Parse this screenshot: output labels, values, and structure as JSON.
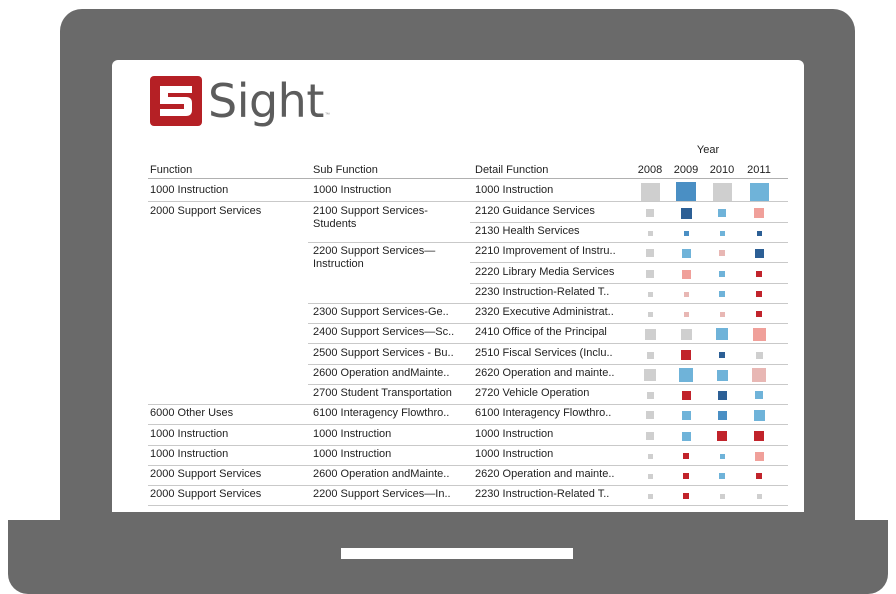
{
  "brand": {
    "logo_digit": "5",
    "logo_text": "Sight",
    "tm": "™"
  },
  "table": {
    "year_title": "Year",
    "headers": {
      "function": "Function",
      "sub_function": "Sub Function",
      "detail_function": "Detail Function"
    },
    "years": [
      "2008",
      "2009",
      "2010",
      "2011"
    ],
    "colors": {
      "grey": "#cfcfcf",
      "light_blue": "#6fb3d9",
      "blue": "#4a8fc4",
      "navy": "#2c5f95",
      "salmon": "#f0a09a",
      "pink": "#e8b7b4",
      "red": "#c1232b"
    },
    "rows": [
      {
        "function": "1000   Instruction",
        "sub": "1000   Instruction",
        "detail": "1000   Instruction",
        "size": "xl",
        "marks": [
          {
            "color": "grey",
            "level": 0.95
          },
          {
            "color": "blue",
            "level": 1.0
          },
          {
            "color": "grey",
            "level": 0.9
          },
          {
            "color": "light_blue",
            "level": 0.95
          }
        ]
      },
      {
        "function": "2000   Support Services",
        "sub": "2100   Support Services-Students",
        "detail": "2120   Guidance Services",
        "marks": [
          {
            "color": "grey",
            "level": 0.25
          },
          {
            "color": "navy",
            "level": 0.45
          },
          {
            "color": "light_blue",
            "level": 0.25
          },
          {
            "color": "salmon",
            "level": 0.4
          }
        ]
      },
      {
        "function": "",
        "sub": "",
        "detail": "2130   Health Services",
        "marks": [
          {
            "color": "grey",
            "level": 0.08
          },
          {
            "color": "blue",
            "level": 0.1
          },
          {
            "color": "light_blue",
            "level": 0.1
          },
          {
            "color": "navy",
            "level": 0.1
          }
        ]
      },
      {
        "function": "",
        "sub": "2200   Support Services—Instruction",
        "detail": "2210   Improvement of Instru..",
        "marks": [
          {
            "color": "grey",
            "level": 0.25
          },
          {
            "color": "light_blue",
            "level": 0.3
          },
          {
            "color": "pink",
            "level": 0.15
          },
          {
            "color": "navy",
            "level": 0.35
          }
        ]
      },
      {
        "function": "",
        "sub": "",
        "detail": "2220   Library Media Services",
        "marks": [
          {
            "color": "grey",
            "level": 0.25
          },
          {
            "color": "salmon",
            "level": 0.3
          },
          {
            "color": "light_blue",
            "level": 0.12
          },
          {
            "color": "red",
            "level": 0.15
          }
        ]
      },
      {
        "function": "",
        "sub": "",
        "detail": "2230   Instruction-Related T..",
        "marks": [
          {
            "color": "grey",
            "level": 0.08
          },
          {
            "color": "pink",
            "level": 0.1
          },
          {
            "color": "light_blue",
            "level": 0.15
          },
          {
            "color": "red",
            "level": 0.12
          }
        ]
      },
      {
        "function": "",
        "sub": "2300   Support Services-Ge..",
        "detail": "2320   Executive Administrat..",
        "marks": [
          {
            "color": "grey",
            "level": 0.08
          },
          {
            "color": "pink",
            "level": 0.1
          },
          {
            "color": "pink",
            "level": 0.1
          },
          {
            "color": "red",
            "level": 0.12
          }
        ]
      },
      {
        "function": "",
        "sub": "2400   Support Services—Sc..",
        "detail": "2410   Office of the Principal",
        "marks": [
          {
            "color": "grey",
            "level": 0.45
          },
          {
            "color": "grey",
            "level": 0.45
          },
          {
            "color": "light_blue",
            "level": 0.55
          },
          {
            "color": "salmon",
            "level": 0.7
          }
        ]
      },
      {
        "function": "",
        "sub": "2500   Support Services - Bu..",
        "detail": "2510   Fiscal Services (Inclu..",
        "marks": [
          {
            "color": "grey",
            "level": 0.2
          },
          {
            "color": "red",
            "level": 0.4
          },
          {
            "color": "navy",
            "level": 0.12
          },
          {
            "color": "grey",
            "level": 0.2
          }
        ]
      },
      {
        "function": "",
        "sub": "2600   Operation andMainte..",
        "detail": "2620   Operation and mainte..",
        "marks": [
          {
            "color": "grey",
            "level": 0.6
          },
          {
            "color": "light_blue",
            "level": 0.75
          },
          {
            "color": "light_blue",
            "level": 0.45
          },
          {
            "color": "pink",
            "level": 0.75
          }
        ]
      },
      {
        "function": "",
        "sub": "2700   Student Transportation",
        "detail": "2720   Vehicle Operation",
        "marks": [
          {
            "color": "grey",
            "level": 0.2
          },
          {
            "color": "red",
            "level": 0.35
          },
          {
            "color": "navy",
            "level": 0.35
          },
          {
            "color": "light_blue",
            "level": 0.25
          }
        ]
      },
      {
        "function": "6000   Other Uses",
        "sub": "6100   Interagency Flowthro..",
        "detail": "6100   Interagency Flowthro..",
        "marks": [
          {
            "color": "grey",
            "level": 0.25
          },
          {
            "color": "light_blue",
            "level": 0.3
          },
          {
            "color": "blue",
            "level": 0.35
          },
          {
            "color": "light_blue",
            "level": 0.45
          }
        ]
      },
      {
        "function": "1000   Instruction",
        "sub": "1000   Instruction",
        "detail": "1000   Instruction",
        "marks": [
          {
            "color": "grey",
            "level": 0.25
          },
          {
            "color": "light_blue",
            "level": 0.3
          },
          {
            "color": "red",
            "level": 0.4
          },
          {
            "color": "red",
            "level": 0.4
          }
        ]
      },
      {
        "function": "1000   Instruction",
        "sub": "1000   Instruction",
        "detail": "1000   Instruction",
        "marks": [
          {
            "color": "grey",
            "level": 0.08
          },
          {
            "color": "red",
            "level": 0.15
          },
          {
            "color": "light_blue",
            "level": 0.1
          },
          {
            "color": "salmon",
            "level": 0.3
          }
        ]
      },
      {
        "function": "2000   Support Services",
        "sub": "2600   Operation andMainte..",
        "detail": "2620   Operation and mainte..",
        "marks": [
          {
            "color": "grey",
            "level": 0.08
          },
          {
            "color": "red",
            "level": 0.12
          },
          {
            "color": "light_blue",
            "level": 0.12
          },
          {
            "color": "red",
            "level": 0.15
          }
        ]
      },
      {
        "function": "2000   Support Services",
        "sub": "2200   Support Services—In..",
        "detail": "2230   Instruction-Related T..",
        "marks": [
          {
            "color": "grey",
            "level": 0.08
          },
          {
            "color": "red",
            "level": 0.15
          },
          {
            "color": "grey",
            "level": 0.08
          },
          {
            "color": "grey",
            "level": 0.08
          }
        ]
      }
    ]
  }
}
